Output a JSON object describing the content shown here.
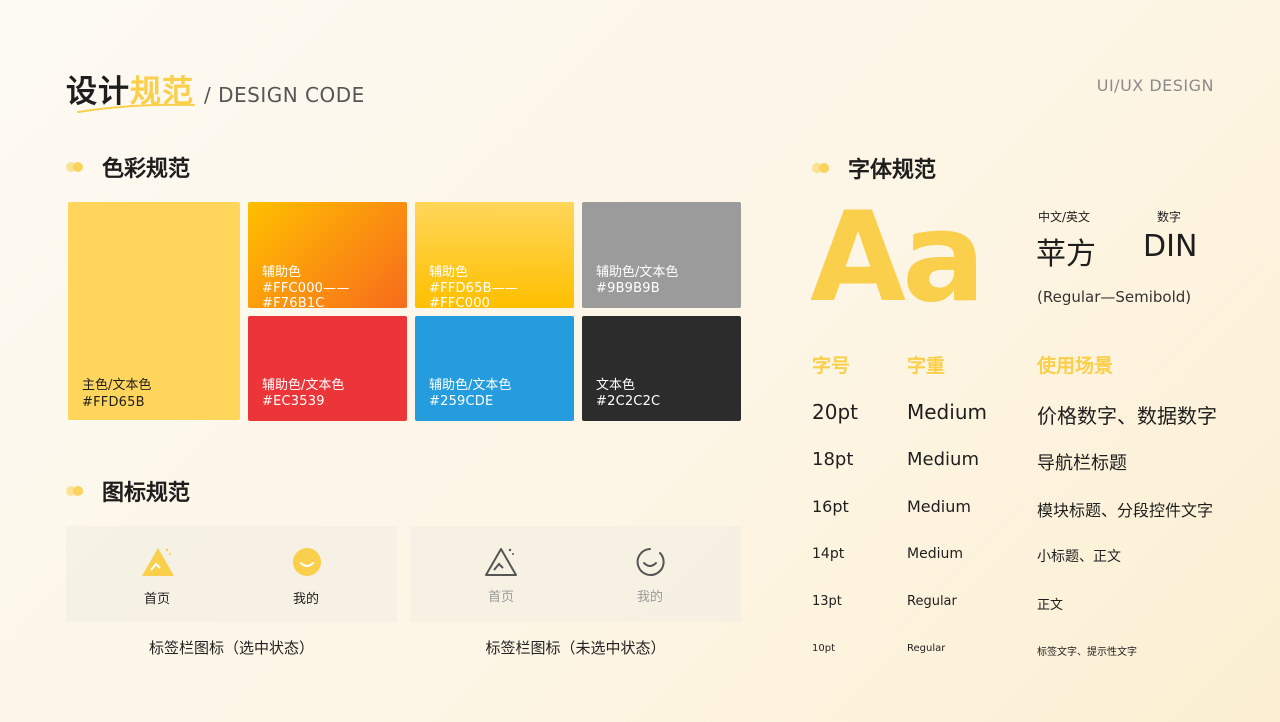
{
  "header": {
    "title_part1": "设计",
    "title_part2": "规范",
    "subtitle": "/ DESIGN CODE",
    "brand": "UI/UX DESIGN"
  },
  "colors": {
    "section_title": "色彩规范",
    "primary": {
      "label": "主色/文本色",
      "hex": "#FFD65B"
    },
    "swatches": [
      {
        "label": "辅助色",
        "hex": "#FFC000——#F76B1C"
      },
      {
        "label": "辅助色",
        "hex": "#FFD65B——#FFC000"
      },
      {
        "label": "辅助色/文本色",
        "hex": "#9B9B9B"
      },
      {
        "label": "辅助色/文本色",
        "hex": "#EC3539"
      },
      {
        "label": "辅助色/文本色",
        "hex": "#259CDE"
      },
      {
        "label": "文本色",
        "hex": "#2C2C2C"
      }
    ]
  },
  "icons": {
    "section_title": "图标规范",
    "selected": {
      "home": "首页",
      "me": "我的",
      "caption": "标签栏图标（选中状态）"
    },
    "unselected": {
      "home": "首页",
      "me": "我的",
      "caption": "标签栏图标（未选中状态）"
    },
    "icon_names": [
      "home-icon",
      "smile-icon"
    ]
  },
  "fonts": {
    "section_title": "字体规范",
    "sample": "Aa",
    "cn_en_label": "中文/英文",
    "cn_en_font": "苹方",
    "num_label": "数字",
    "num_font": "DIN",
    "weight_range": "(Regular—Semibold)",
    "headers": {
      "size": "字号",
      "weight": "字重",
      "usage": "使用场景"
    },
    "rows": [
      {
        "size": "20pt",
        "weight": "Medium",
        "usage": "价格数字、数据数字"
      },
      {
        "size": "18pt",
        "weight": "Medium",
        "usage": "导航栏标题"
      },
      {
        "size": "16pt",
        "weight": "Medium",
        "usage": "模块标题、分段控件文字"
      },
      {
        "size": "14pt",
        "weight": "Medium",
        "usage": "小标题、正文"
      },
      {
        "size": "13pt",
        "weight": "Regular",
        "usage": "正文"
      },
      {
        "size": "10pt",
        "weight": "Regular",
        "usage": "标签文字、提示性文字"
      }
    ]
  },
  "palette": {
    "accent": "#FFD65B",
    "accent_dark": "#F9CF4C",
    "red": "#EC3539",
    "blue": "#259CDE",
    "gray": "#9B9B9B",
    "dark": "#2C2C2C"
  }
}
